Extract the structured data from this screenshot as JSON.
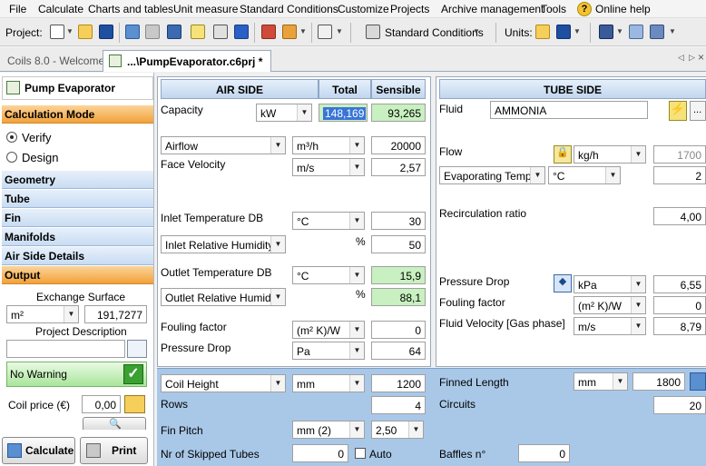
{
  "menu": {
    "file": "File",
    "calculate": "Calculate",
    "charts": "Charts and tables",
    "unit": "Unit measure",
    "standard": "Standard Conditions",
    "customize": "Customize",
    "projects": "Projects",
    "archive": "Archive management",
    "tools": "Tools",
    "help": "Online help"
  },
  "toolbar": {
    "project_label": "Project:",
    "standard_label": "Standard Conditions",
    "units_label": "Units:"
  },
  "tabs": {
    "welcome": "Coils 8.0 - Welcome!",
    "project": "...\\PumpEvaporator.c6prj *"
  },
  "sidebar": {
    "title": "Pump Evaporator",
    "calc_mode": "Calculation Mode",
    "verify": "Verify",
    "design": "Design",
    "geometry": "Geometry",
    "tube": "Tube",
    "fin": "Fin",
    "manifolds": "Manifolds",
    "air_details": "Air Side Details",
    "output": "Output",
    "exchange_surface": "Exchange Surface",
    "surface_unit": "m²",
    "surface_value": "191,7277",
    "project_desc": "Project Description",
    "project_desc_value": "",
    "warning": "No Warning",
    "coil_price": "Coil price (€)",
    "coil_price_value": "0,00",
    "calculate": "Calculate",
    "print": "Print"
  },
  "air": {
    "header": "AIR SIDE",
    "total": "Total",
    "sensible": "Sensible",
    "capacity": "Capacity",
    "capacity_unit": "kW",
    "capacity_total": "148,169",
    "capacity_sensible": "93,265",
    "airflow": "Airflow",
    "airflow_unit": "m³/h",
    "airflow_value": "20000",
    "face_velocity": "Face Velocity",
    "fv_unit": "m/s",
    "fv_value": "2,57",
    "inlet_temp": "Inlet Temperature DB",
    "inlet_temp_unit": "°C",
    "inlet_temp_value": "30",
    "inlet_rh": "Inlet Relative Humidity",
    "inlet_rh_unit": "%",
    "inlet_rh_value": "50",
    "outlet_temp": "Outlet Temperature DB",
    "outlet_temp_unit": "°C",
    "outlet_temp_value": "15,9",
    "outlet_rh": "Outlet Relative Humidity",
    "outlet_rh_unit": "%",
    "outlet_rh_value": "88,1",
    "fouling": "Fouling factor",
    "fouling_unit": "(m² K)/W",
    "fouling_value": "0",
    "pressure_drop": "Pressure Drop",
    "pd_unit": "Pa",
    "pd_value": "64"
  },
  "tube": {
    "header": "TUBE SIDE",
    "fluid": "Fluid",
    "fluid_value": "AMMONIA",
    "flow": "Flow",
    "flow_unit": "kg/h",
    "flow_value": "1700",
    "evap_temp": "Evaporating Temp.",
    "evap_unit": "°C",
    "evap_value": "2",
    "recirculation": "Recirculation ratio",
    "recirculation_value": "4,00",
    "pressure_drop": "Pressure Drop",
    "pd_unit": "kPa",
    "pd_value": "6,55",
    "fouling": "Fouling factor",
    "fouling_unit": "(m² K)/W",
    "fouling_value": "0",
    "fluid_velocity": "Fluid Velocity [Gas phase]",
    "fv_unit": "m/s",
    "fv_value": "8,79"
  },
  "geometry": {
    "coil_height": "Coil Height",
    "coil_height_unit": "mm",
    "coil_height_value": "1200",
    "rows": "Rows",
    "rows_value": "4",
    "fin_pitch": "Fin Pitch",
    "fin_pitch_unit": "mm (2)",
    "fin_pitch_value": "2,50",
    "skipped": "Nr of Skipped Tubes",
    "skipped_value": "0",
    "auto": "Auto",
    "finned_length": "Finned Length",
    "finned_length_unit": "mm",
    "finned_length_value": "1800",
    "circuits": "Circuits",
    "circuits_value": "20",
    "baffles": "Baffles n°",
    "baffles_value": "0"
  },
  "colors": {
    "accent_orange": "#f2a13a",
    "section_blue": "#c9dcf2",
    "bottom_blue": "#a9c8e8",
    "result_green": "#c8f0c0",
    "selection_blue": "#3875d7"
  }
}
